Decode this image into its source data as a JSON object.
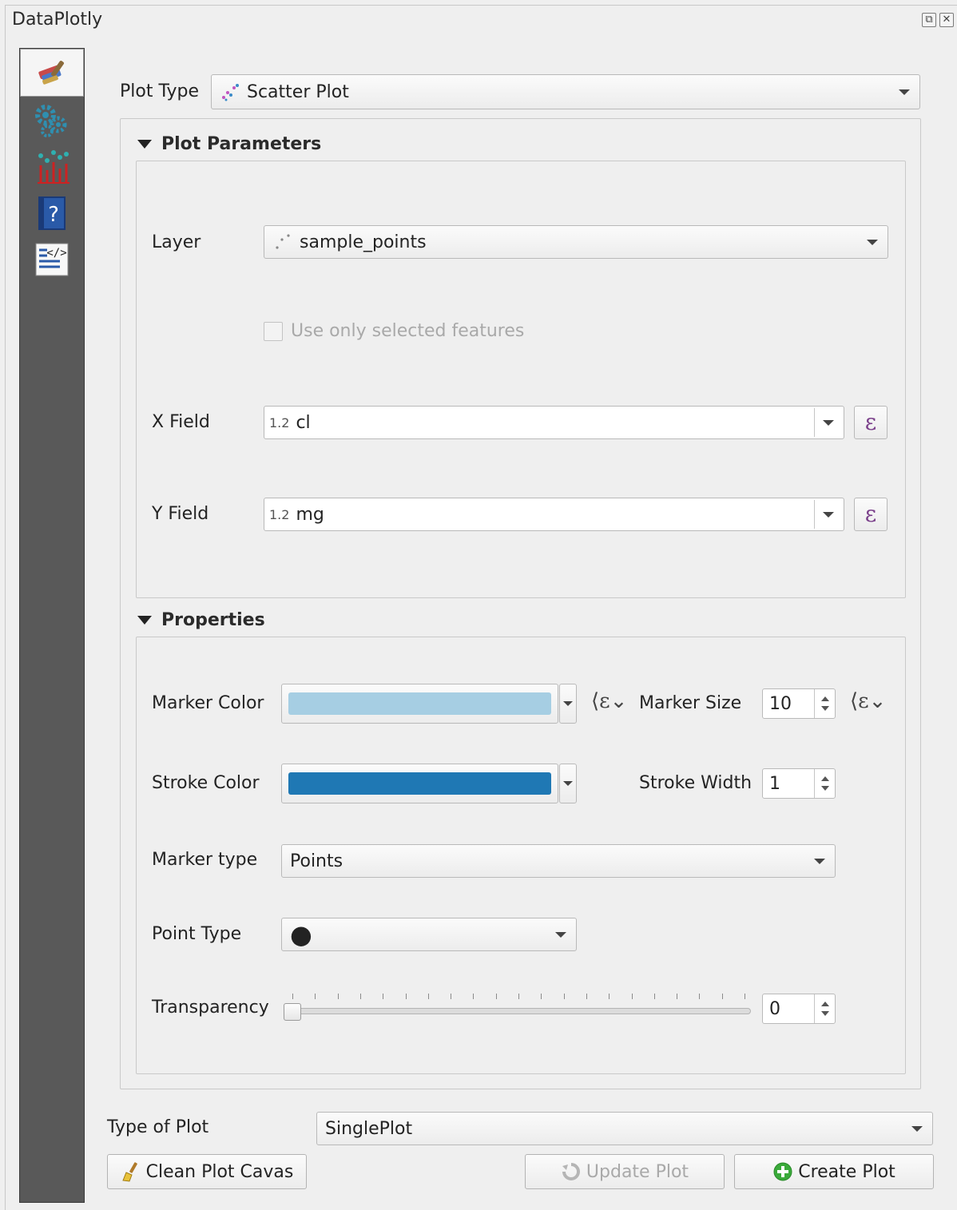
{
  "window": {
    "title": "DataPlotly",
    "float_icon": "float-icon",
    "close_icon": "close-icon"
  },
  "sidebar": {
    "items": [
      {
        "icon": "paint-brush-icon",
        "active": true
      },
      {
        "icon": "gears-icon",
        "active": false
      },
      {
        "icon": "chart-icon",
        "active": false
      },
      {
        "icon": "help-icon",
        "active": false
      },
      {
        "icon": "code-icon",
        "active": false
      }
    ]
  },
  "plot_type": {
    "label": "Plot Type",
    "value": "Scatter Plot",
    "icon": "scatter-plot-icon"
  },
  "plot_parameters": {
    "title": "Plot Parameters",
    "layer_label": "Layer",
    "layer_value": "sample_points",
    "selected_features_label": "Use only selected features",
    "x_field_label": "X Field",
    "x_field_type": "1.2",
    "x_field_value": "cl",
    "y_field_label": "Y Field",
    "y_field_type": "1.2",
    "y_field_value": "mg",
    "expression_symbol": "ε"
  },
  "properties": {
    "title": "Properties",
    "marker_color_label": "Marker Color",
    "marker_color": "#a6cee3",
    "marker_size_label": "Marker Size",
    "marker_size_value": "10",
    "stroke_color_label": "Stroke Color",
    "stroke_color": "#1f78b4",
    "stroke_width_label": "Stroke Width",
    "stroke_width_value": "1",
    "marker_type_label": "Marker type",
    "marker_type_value": "Points",
    "point_type_label": "Point Type",
    "point_type_symbol": "●",
    "transparency_label": "Transparency",
    "transparency_value": "0",
    "transparency_level": 0
  },
  "footer": {
    "type_of_plot_label": "Type of Plot",
    "type_of_plot_value": "SinglePlot",
    "clean_button": "Clean Plot Cavas",
    "update_button": "Update Plot",
    "create_button": "Create Plot"
  }
}
